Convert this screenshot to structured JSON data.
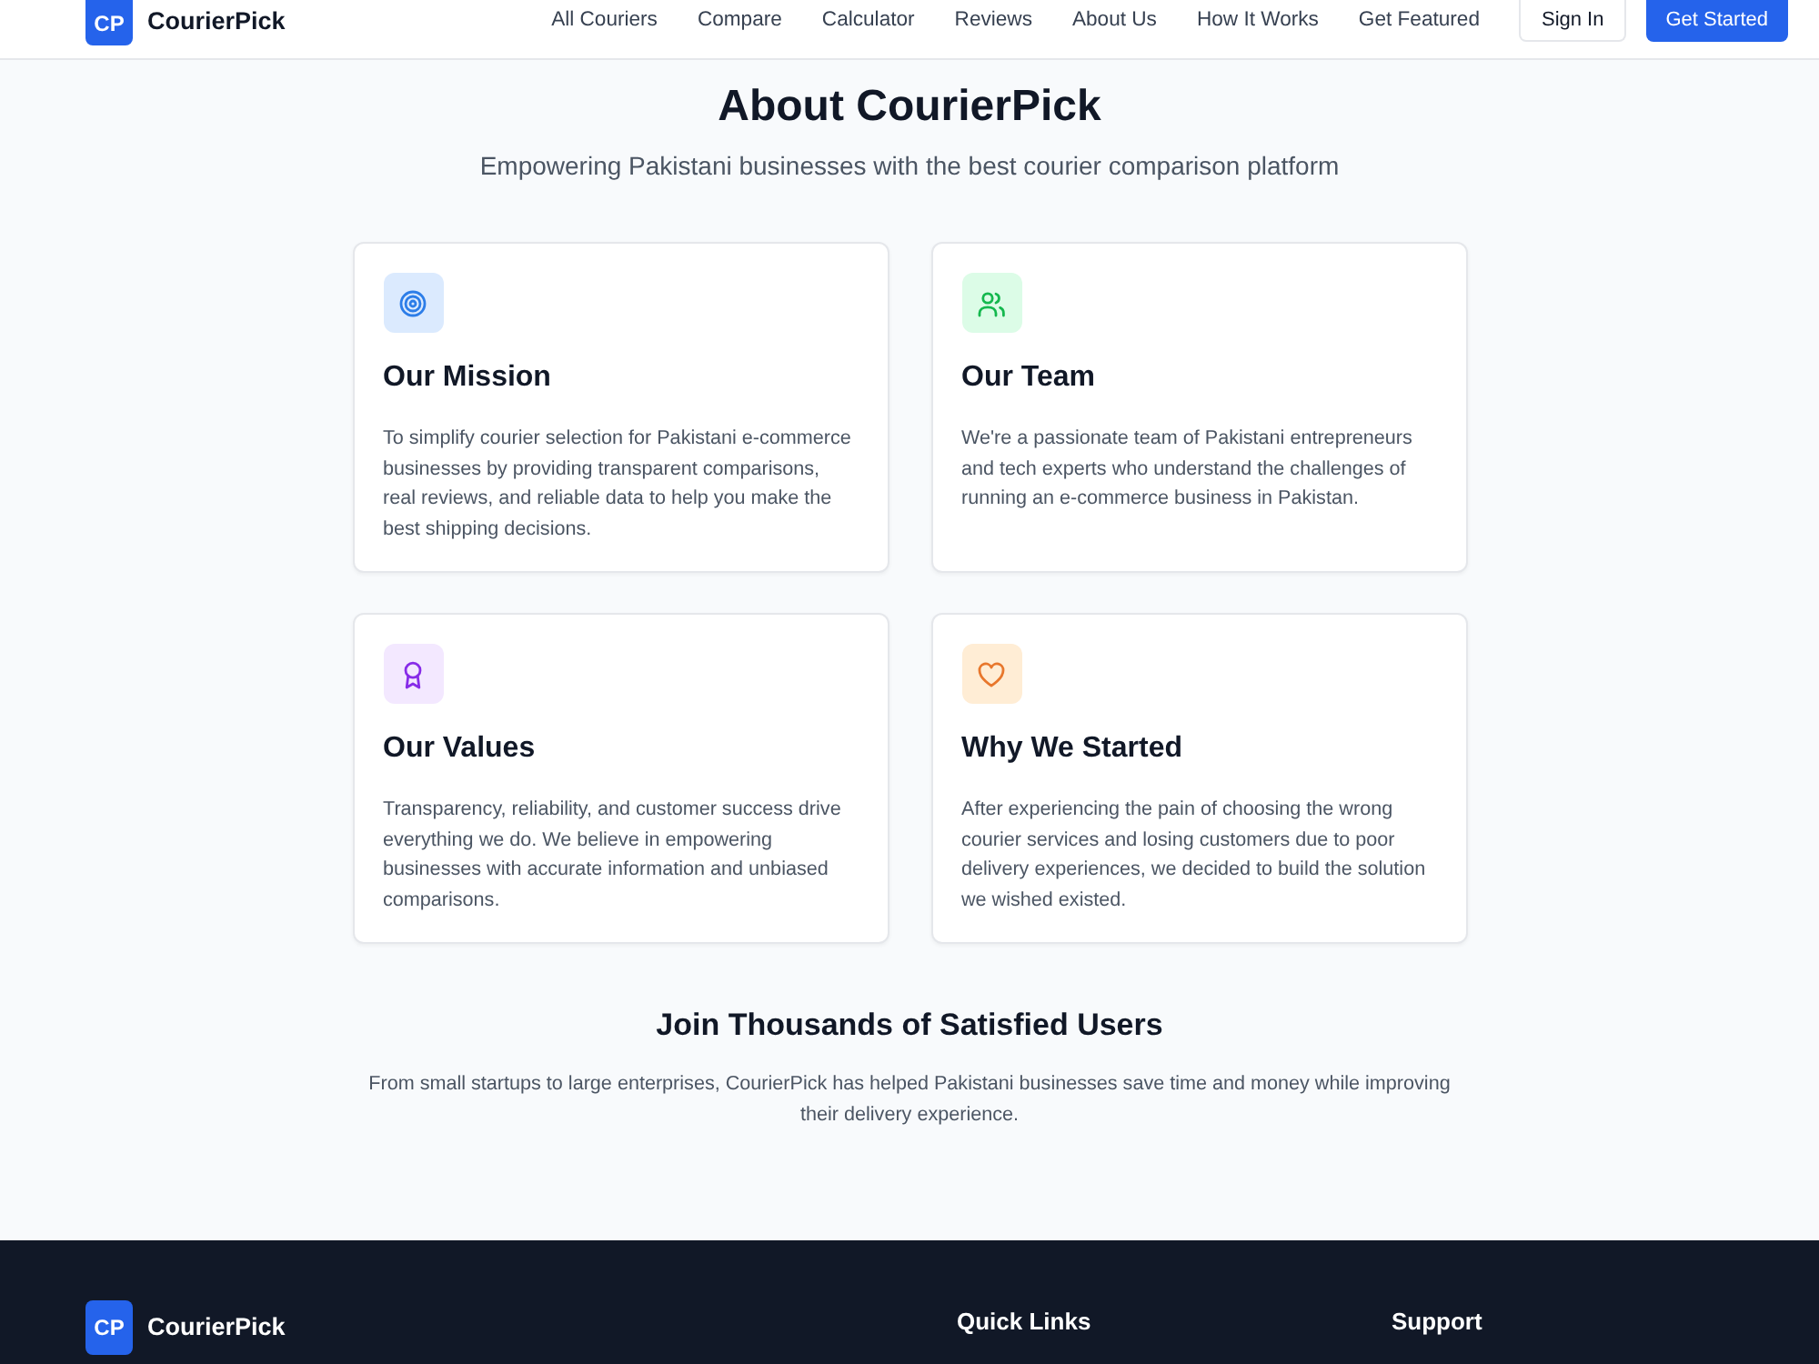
{
  "header": {
    "logo": {
      "mark": "CP",
      "name": "CourierPick"
    },
    "nav": [
      "All Couriers",
      "Compare",
      "Calculator",
      "Reviews",
      "About Us",
      "How It Works",
      "Get Featured"
    ],
    "buttons": [
      {
        "label": "Sign In",
        "kind": "outline"
      },
      {
        "label": "Get Started",
        "kind": "primary"
      }
    ]
  },
  "hero": {
    "title": "About CourierPick",
    "subtitle": "Empowering Pakistani businesses with the best courier comparison platform"
  },
  "cards": [
    {
      "title": "Our Mission",
      "text": "To simplify courier selection for Pakistani e-commerce businesses by providing transparent comparisons, real reviews, and reliable data to help you make the best shipping decisions.",
      "color": "#dbeafe"
    },
    {
      "title": "Our Team",
      "text": "We're a passionate team of Pakistani entrepreneurs and tech experts who understand the challenges of running an e-commerce business in Pakistan.",
      "color": "#dcfce7"
    },
    {
      "title": "Our Values",
      "text": "Transparency, reliability, and customer success drive everything we do. We believe in empowering businesses with accurate information and unbiased comparisons.",
      "color": "#f3e8ff"
    },
    {
      "title": "Why We Started",
      "text": "After experiencing the pain of choosing the wrong courier services and losing customers due to poor delivery experiences, we decided to build the solution we wished existed.",
      "color": "#ffedd5"
    }
  ],
  "join": {
    "title": "Join Thousands of Satisfied Users",
    "text": "From small startups to large enterprises, CourierPick has helped Pakistani businesses save time and money while improving their delivery experience."
  },
  "footer": {
    "logo": {
      "mark": "CP",
      "name": "CourierPick"
    },
    "columns": [
      "Quick Links",
      "Support"
    ]
  }
}
